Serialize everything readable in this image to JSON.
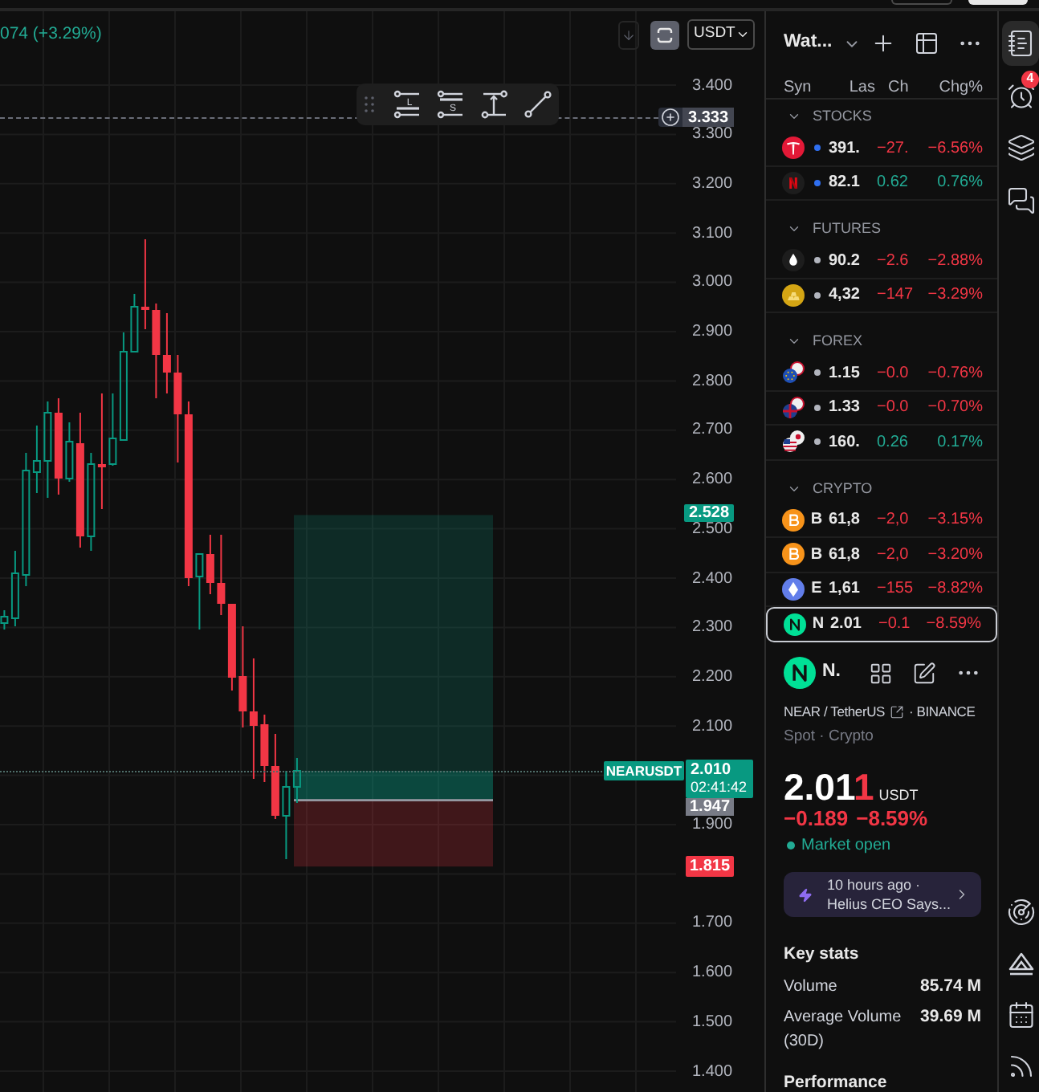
{
  "chart": {
    "legend": {
      "change": "074 (+3.29%)"
    },
    "controls": {
      "scale_toggle": {
        "on": true
      },
      "currency": {
        "value": "USDT"
      }
    },
    "drawing_toolbar": {
      "tools": [
        {
          "kind": "long_position",
          "letter": "L"
        },
        {
          "kind": "short_position",
          "letter": "S"
        },
        {
          "kind": "price_range"
        },
        {
          "kind": "trend_line"
        }
      ]
    },
    "price_axis": {
      "ticks": [
        "3.400",
        "3.300",
        "3.200",
        "3.100",
        "3.000",
        "2.900",
        "2.800",
        "2.700",
        "2.600",
        "2.500",
        "2.400",
        "2.300",
        "2.200",
        "2.100",
        "1.900",
        "1.700",
        "1.600",
        "1.500",
        "1.400"
      ]
    },
    "alert": {
      "price": "3.333"
    },
    "position": {
      "target": "2.528",
      "entry": "1.947",
      "stop": "1.815"
    },
    "last_price": {
      "symbol": "NEARUSDT",
      "price": "2.010",
      "countdown": "02:41:42"
    }
  },
  "watchlist": {
    "title": "Wat...",
    "columns": [
      "Syn",
      "Las",
      "Ch",
      "Chg%"
    ],
    "sections": [
      {
        "name": "STOCKS",
        "expanded": true,
        "rows": [
          {
            "kind": "tesla",
            "color": "#2f6ff0",
            "last": "391.",
            "change": "−27.",
            "change_pct": "−6.56%",
            "falling": true,
            "selected": false
          },
          {
            "kind": "netflix",
            "color": "#2f6ff0",
            "last": "82.1",
            "change": "0.62",
            "change_pct": "0.76%",
            "falling": false,
            "selected": false
          }
        ]
      },
      {
        "name": "FUTURES",
        "expanded": true,
        "rows": [
          {
            "kind": "oil",
            "color": "#b2b5be",
            "last": "90.2",
            "change": "−2.6",
            "change_pct": "−2.88%",
            "falling": true,
            "selected": false
          },
          {
            "kind": "gold",
            "color": "#b2b5be",
            "last": "4,32",
            "change": "−147",
            "change_pct": "−3.29%",
            "falling": true,
            "selected": false
          }
        ]
      },
      {
        "name": "FOREX",
        "expanded": true,
        "rows": [
          {
            "kind": "eur_usd",
            "color": "#b2b5be",
            "last": "1.15",
            "change": "−0.0",
            "change_pct": "−0.76%",
            "falling": true,
            "selected": false
          },
          {
            "kind": "gbp_usd",
            "color": "#b2b5be",
            "last": "1.33",
            "change": "−0.0",
            "change_pct": "−0.70%",
            "falling": true,
            "selected": false
          },
          {
            "kind": "usd_jpy",
            "color": "#b2b5be",
            "last": "160.",
            "change": "0.26",
            "change_pct": "0.17%",
            "falling": false,
            "selected": false
          }
        ]
      },
      {
        "name": "CRYPTO",
        "expanded": true,
        "rows": [
          {
            "kind": "bitcoin",
            "symbol": "B",
            "last": "61,8",
            "change": "−2,0",
            "change_pct": "−3.15%",
            "falling": true,
            "selected": false
          },
          {
            "kind": "bitcoin",
            "symbol": "B",
            "last": "61,8",
            "change": "−2,0",
            "change_pct": "−3.20%",
            "falling": true,
            "selected": false
          },
          {
            "kind": "ethereum",
            "symbol": "E",
            "last": "1,61",
            "change": "−155",
            "change_pct": "−8.82%",
            "falling": true,
            "selected": false
          },
          {
            "kind": "near",
            "symbol": "N",
            "last": "2.01",
            "change": "−0.1",
            "change_pct": "−8.59%",
            "falling": true,
            "selected": true
          }
        ]
      }
    ]
  },
  "symbol_details": {
    "icon": {
      "kind": "near"
    },
    "name": "N.",
    "pair": "NEAR / TetherUS",
    "exchange": "· BINANCE",
    "market": "Spot · Crypto",
    "price": "2.01",
    "price_last_digit": "1",
    "last_tick_falling": true,
    "currency": "USDT",
    "change": "−0.189",
    "change_pct": "−8.59%",
    "falling": true,
    "status": "Market open",
    "news": {
      "time": "10 hours ago ·",
      "headline": "Helius CEO Says..."
    },
    "key_stats": {
      "title": "Key stats",
      "rows": [
        {
          "label": "Volume",
          "value": "85.74 M"
        },
        {
          "label": "Average Volume (30D)",
          "value": "39.69 M"
        }
      ]
    },
    "next_section": "Performance"
  },
  "right_toolbar": {
    "top": [
      {
        "kind": "watchlist",
        "selected": true
      },
      {
        "kind": "alerts",
        "selected": false,
        "badge": "4"
      },
      {
        "kind": "layers",
        "selected": false
      },
      {
        "kind": "chat",
        "selected": false
      }
    ],
    "bottom": [
      {
        "kind": "target"
      },
      {
        "kind": "triangles"
      },
      {
        "kind": "calendar"
      },
      {
        "kind": "broadcast"
      }
    ]
  }
}
